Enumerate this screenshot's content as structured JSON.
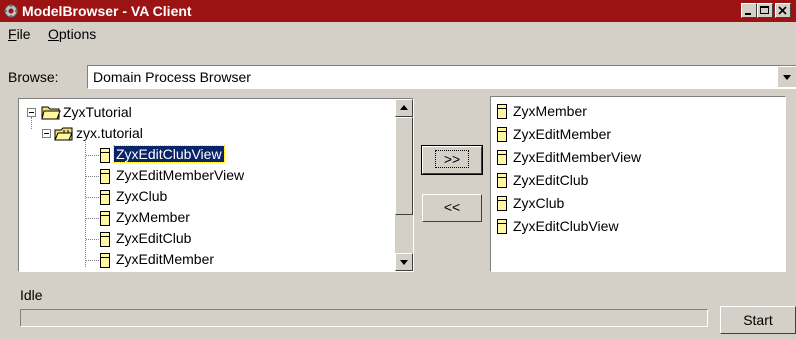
{
  "window": {
    "title": "ModelBrowser - VA Client",
    "controls": [
      "minimize-icon",
      "maximize-icon",
      "close-icon"
    ]
  },
  "menu": {
    "items": [
      {
        "label": "ile",
        "mnemonic": "F"
      },
      {
        "label": "ptions",
        "mnemonic": "O"
      }
    ]
  },
  "browse": {
    "label": "Browse:",
    "selected": "Domain Process Browser"
  },
  "tree": {
    "root": "ZyxTutorial",
    "package": "zyx.tutorial",
    "items": [
      {
        "label": "ZyxEditClubView",
        "selected": true
      },
      {
        "label": "ZyxEditMemberView",
        "selected": false
      },
      {
        "label": "ZyxClub",
        "selected": false
      },
      {
        "label": "ZyxMember",
        "selected": false
      },
      {
        "label": "ZyxEditClub",
        "selected": false
      },
      {
        "label": "ZyxEditMember",
        "selected": false
      }
    ]
  },
  "transfer": {
    "add_label": ">>",
    "remove_label": "<<"
  },
  "selected_list": {
    "items": [
      "ZyxMember",
      "ZyxEditMember",
      "ZyxEditMemberView",
      "ZyxEditClub",
      "ZyxClub",
      "ZyxEditClubView"
    ]
  },
  "status": {
    "text": "Idle",
    "progress": 0,
    "start_label": "Start"
  },
  "colors": {
    "titlebar": "#9b1313",
    "face": "#d4d0c8",
    "selection": "#0a246a",
    "class_icon": "#fff8a0"
  }
}
